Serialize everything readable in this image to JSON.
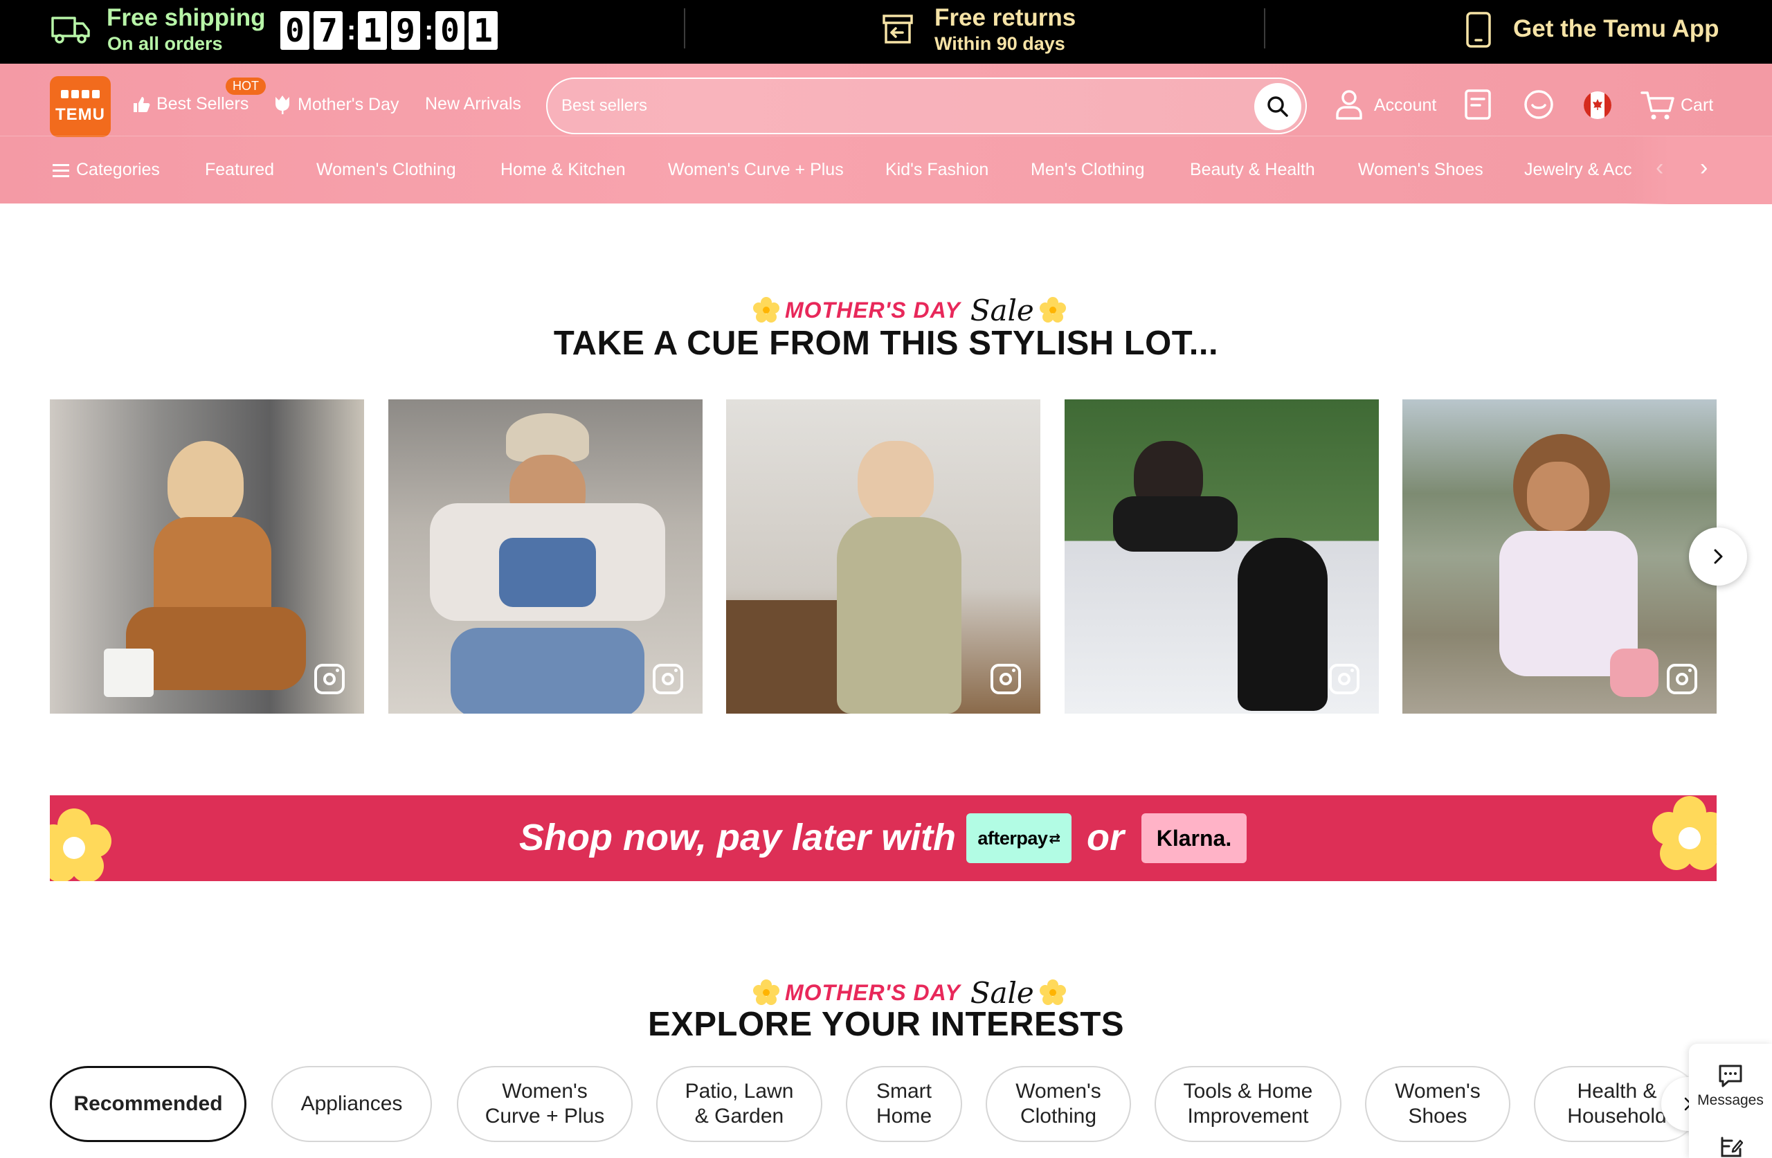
{
  "promo": {
    "shipping_title": "Free shipping",
    "shipping_sub": "On all orders",
    "countdown": [
      "0",
      "7",
      "1",
      "9",
      "0",
      "1"
    ],
    "returns_title": "Free returns",
    "returns_sub": "Within 90 days",
    "app_text": "Get the Temu App"
  },
  "header": {
    "logo_text": "TEMU",
    "nav": {
      "best_sellers": "Best Sellers",
      "hot_badge": "HOT",
      "mothers_day": "Mother's Day",
      "new_arrivals": "New Arrivals"
    },
    "search": {
      "placeholder": "Best sellers"
    },
    "account_label": "Account",
    "cart_label": "Cart"
  },
  "categories": {
    "label": "Categories",
    "items": [
      "Featured",
      "Women's Clothing",
      "Home & Kitchen",
      "Women's Curve + Plus",
      "Kid's Fashion",
      "Men's Clothing",
      "Beauty & Health",
      "Women's Shoes",
      "Jewelry & Acc"
    ]
  },
  "badge": {
    "main": "MOTHER'S DAY",
    "sale": "Sale"
  },
  "lookbook": {
    "title": "TAKE A CUE FROM THIS STYLISH LOT..."
  },
  "bnpl": {
    "text": "Shop now, pay later with",
    "afterpay": "afterpay",
    "or": "or",
    "klarna": "Klarna."
  },
  "interests": {
    "title": "EXPLORE YOUR INTERESTS",
    "pills": [
      {
        "line1": "Recommended",
        "line2": ""
      },
      {
        "line1": "Appliances",
        "line2": ""
      },
      {
        "line1": "Women's",
        "line2": "Curve + Plus"
      },
      {
        "line1": "Patio, Lawn",
        "line2": "& Garden"
      },
      {
        "line1": "Smart",
        "line2": "Home"
      },
      {
        "line1": "Women's",
        "line2": "Clothing"
      },
      {
        "line1": "Tools & Home",
        "line2": "Improvement"
      },
      {
        "line1": "Women's",
        "line2": "Shoes"
      },
      {
        "line1": "Health &",
        "line2": "Household"
      }
    ]
  },
  "widget": {
    "messages_label": "Messages"
  },
  "colors": {
    "header_pink": "#f8a4ae",
    "brand_orange": "#f26b1d",
    "banner_red": "#dd2f56",
    "promo_green": "#b8f5a8",
    "promo_gold": "#f6e3a6"
  }
}
